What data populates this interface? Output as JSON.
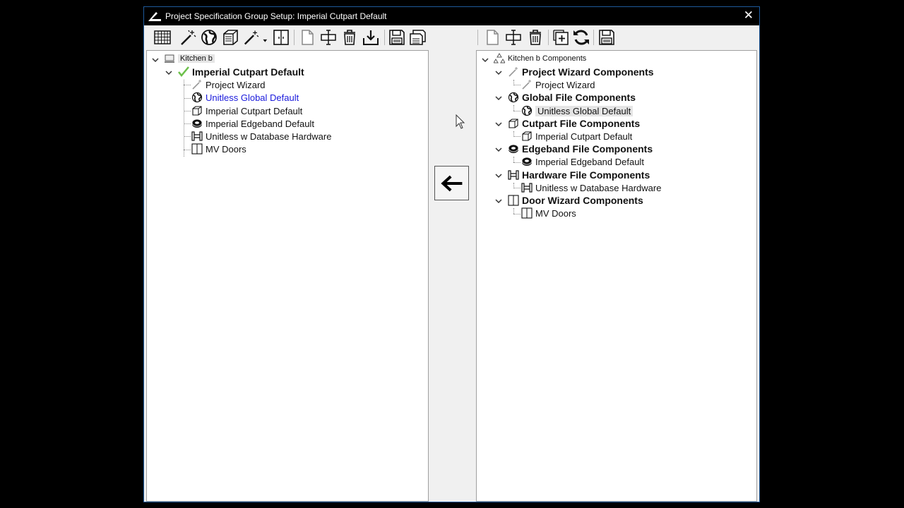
{
  "window": {
    "title": "Project Specification Group Setup: Imperial Cutpart Default",
    "close_glyph": "✕"
  },
  "toolbar_left": [
    "grid-icon",
    "wizard-wand-icon",
    "globe-icon",
    "cutpart-cube-icon",
    "wizard-dropdown-icon",
    "door-icon",
    "new-page-icon",
    "move-item-icon",
    "delete-trash-icon",
    "import-download-icon",
    "save-disk-icon",
    "save-stack-icon"
  ],
  "toolbar_right": [
    "new-page-icon",
    "move-item-icon",
    "delete-trash-icon",
    "add-new-icon",
    "refresh-icon",
    "save-disk-icon"
  ],
  "left_tree": {
    "root": "Kitchen b",
    "group": "Imperial Cutpart Default",
    "items": [
      "Project Wizard",
      "Unitless Global Default",
      "Imperial Cutpart Default",
      "Imperial Edgeband Default",
      "Unitless w Database Hardware",
      "MV Doors"
    ]
  },
  "right_tree": {
    "root": "Kitchen b Components",
    "groups": [
      {
        "label": "Project Wizard Components",
        "item": "Project Wizard"
      },
      {
        "label": "Global File Components",
        "item": "Unitless Global Default"
      },
      {
        "label": "Cutpart File Components",
        "item": "Imperial Cutpart Default"
      },
      {
        "label": "Edgeband File Components",
        "item": "Imperial Edgeband Default"
      },
      {
        "label": "Hardware File Components",
        "item": "Unitless w Database Hardware"
      },
      {
        "label": "Door Wizard Components",
        "item": "MV Doors"
      }
    ]
  },
  "colors": {
    "link_blue": "#1a1adc",
    "check_green": "#6cc04a",
    "title_bar": "#000000"
  }
}
